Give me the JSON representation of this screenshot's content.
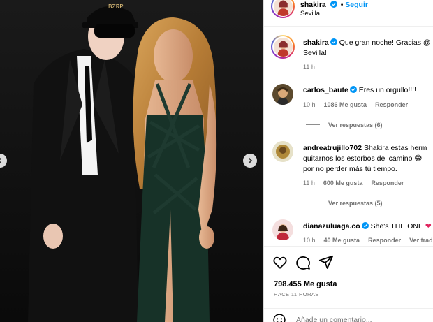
{
  "header": {
    "username": "shakira",
    "follow_label": "Seguir",
    "location": "Sevilla"
  },
  "caption": {
    "username": "shakira",
    "text_line1": "Que gran noche! Gracias @",
    "text_line2": "Sevilla!",
    "time": "11 h"
  },
  "comments": [
    {
      "username": "carlos_baute",
      "verified": true,
      "text": "Eres un orgullo!!!!",
      "time": "10 h",
      "likes": "1086 Me gusta",
      "reply": "Responder",
      "view_replies": "Ver respuestas (6)"
    },
    {
      "username": "andreatrujillo702",
      "verified": false,
      "text_line1": "Shakira estas herm",
      "text_line2": "quitarnos los estorbos del camino",
      "text_line3": "por no perder más tú tiempo.",
      "time": "11 h",
      "likes": "600 Me gusta",
      "reply": "Responder",
      "view_replies": "Ver respuestas (5)"
    },
    {
      "username": "dianazuluaga.co",
      "verified": true,
      "text": "She's THE ONE",
      "time": "10 h",
      "likes": "40 Me gusta",
      "reply": "Responder",
      "translate": "Ver trad"
    }
  ],
  "actions": {
    "likes": "798.455 Me gusta",
    "posted_ago": "HACE 11 HORAS",
    "comment_placeholder": "Añade un comentario..."
  },
  "media": {
    "cap_text": "BZRP"
  },
  "icons": [
    "heart-icon",
    "comment-icon",
    "share-icon",
    "emoji-icon",
    "verified-icon",
    "chevron-left-icon",
    "chevron-right-icon"
  ],
  "colors": {
    "verified": "#0095f6",
    "link": "#0095f6",
    "muted": "#737373"
  }
}
